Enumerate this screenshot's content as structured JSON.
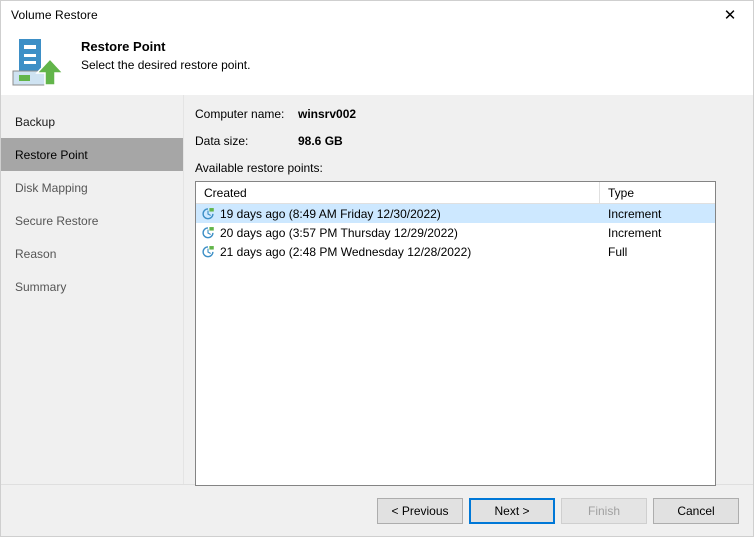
{
  "window": {
    "title": "Volume Restore",
    "close_label": "✕"
  },
  "header": {
    "title": "Restore Point",
    "subtitle": "Select the desired restore point.",
    "icon": "volume-restore-icon"
  },
  "sidebar": {
    "items": [
      {
        "label": "Backup",
        "state": "done"
      },
      {
        "label": "Restore Point",
        "state": "selected"
      },
      {
        "label": "Disk Mapping",
        "state": "pending"
      },
      {
        "label": "Secure Restore",
        "state": "pending"
      },
      {
        "label": "Reason",
        "state": "pending"
      },
      {
        "label": "Summary",
        "state": "pending"
      }
    ]
  },
  "content": {
    "computer_name_label": "Computer name:",
    "computer_name_value": "winsrv002",
    "data_size_label": "Data size:",
    "data_size_value": "98.6 GB",
    "list_caption": "Available restore points:",
    "columns": [
      {
        "key": "created",
        "label": "Created"
      },
      {
        "key": "type",
        "label": "Type"
      }
    ],
    "rows": [
      {
        "icon": "restore-point-icon",
        "created": "19 days ago (8:49 AM Friday 12/30/2022)",
        "type": "Increment",
        "selected": true
      },
      {
        "icon": "restore-point-icon",
        "created": "20 days ago (3:57 PM Thursday 12/29/2022)",
        "type": "Increment",
        "selected": false
      },
      {
        "icon": "restore-point-icon",
        "created": "21 days ago (2:48 PM Wednesday 12/28/2022)",
        "type": "Full",
        "selected": false
      }
    ]
  },
  "footer": {
    "buttons": [
      {
        "label": "< Previous",
        "state": "normal"
      },
      {
        "label": "Next >",
        "state": "default"
      },
      {
        "label": "Finish",
        "state": "disabled"
      },
      {
        "label": "Cancel",
        "state": "normal"
      }
    ]
  },
  "colors": {
    "accent": "#0078d7",
    "selection": "#cde8ff",
    "sidebar_selected": "#a6a6a6",
    "icon_blue": "#3d8fc6",
    "icon_green": "#62b54a",
    "dialog_bg": "#f0f0f0"
  }
}
